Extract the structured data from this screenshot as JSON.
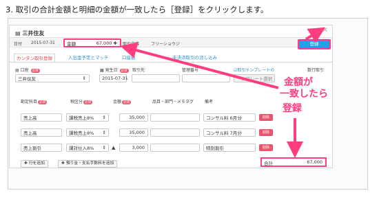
{
  "instruction": "3. 取引の合計金額と明細の金額が一致したら［登録］をクリックします。",
  "dialog": {
    "title": "三井住友",
    "close_icon": "close-icon",
    "date_label": "日付",
    "date_value": "2015-07-31",
    "amount_label": "金額",
    "amount_value": "67,000",
    "content_label": "取引内容",
    "content_value": "フリーショウジ",
    "register_button": "登録"
  },
  "tabs": [
    {
      "label": "カンタン取引登録",
      "active": true
    },
    {
      "label": "入出金予定とマッチ",
      "active": false
    },
    {
      "label": "口座振",
      "active": false
    },
    {
      "label": "未決済取引の消し込み",
      "active": false
    }
  ],
  "form": {
    "account_label": "口座",
    "account_value": "三井住友",
    "occurred_label": "発生日",
    "occurred_value": "2015-07-31",
    "partner_label": "取引先",
    "mgmt_label": "管理番号",
    "template_link": "取引テンプレートの",
    "template_select": "ンプレート選択",
    "recurring_label": "数行取引"
  },
  "table": {
    "headers": [
      "勘定科目",
      "税区分",
      "金額",
      "品目・部門・メモタグ",
      "備考"
    ],
    "required_badge": "必須",
    "rows": [
      {
        "account": "売上高",
        "tax": "課税売上8%",
        "amount": "35,000",
        "memo": "コンサル料 6月分",
        "delete": "削除"
      },
      {
        "account": "売上高",
        "tax": "課税売上8%",
        "amount": "35,000",
        "memo": "コンサル料 7月分",
        "delete": "削除"
      },
      {
        "account": "売上割引",
        "tax": "課対仕入8%",
        "sign": "▲",
        "amount": "3,000",
        "memo": "特別割引",
        "delete": "削除"
      }
    ],
    "add_row": "行を追加",
    "add_fee": "預り金・支払手数料を追加",
    "total_label": "合計",
    "total_value": "67,000"
  },
  "annotation": {
    "line1": "金額が",
    "line2": "一致したら",
    "line3": "登録",
    "color": "#ff3d7f"
  }
}
